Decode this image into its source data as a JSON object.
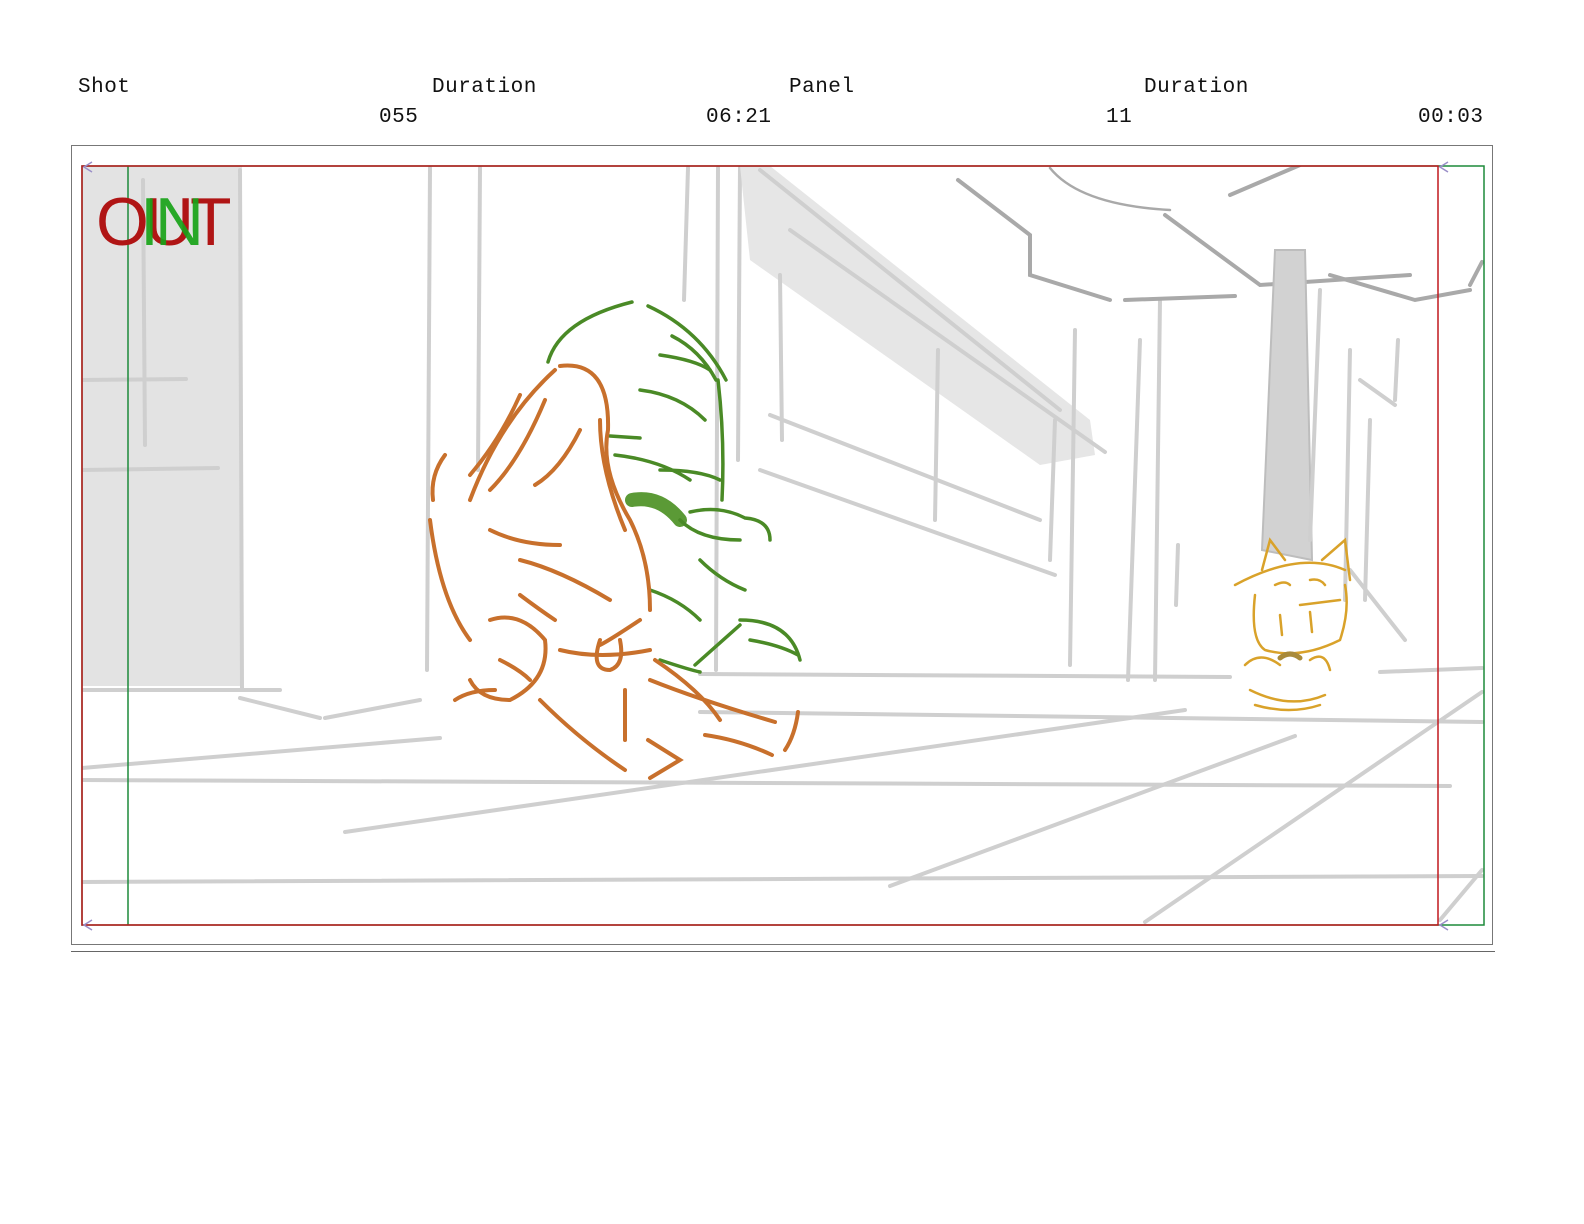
{
  "header": {
    "shot_label": "Shot",
    "shot_value": "055",
    "shot_duration_label": "Duration",
    "shot_duration_value": "06:21",
    "panel_label": "Panel",
    "panel_value": "11",
    "panel_duration_label": "Duration",
    "panel_duration_value": "00:03"
  },
  "panel": {
    "stamp_out": "OUT",
    "stamp_in": "IN",
    "colors": {
      "out_stamp": "#b01515",
      "in_stamp": "#19a319",
      "safe_frame_red": "#c0181e",
      "safe_frame_green": "#1d8a3a",
      "character_orange": "#c8702c",
      "character_green": "#4a8a26",
      "character_yellow": "#d9a22a",
      "background_sketch": "#c9c9c9"
    }
  }
}
